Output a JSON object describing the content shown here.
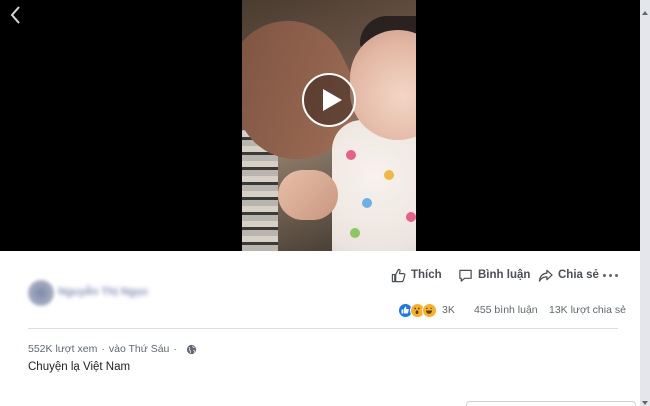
{
  "video": {
    "play_label": "Play video",
    "back_label": "Back"
  },
  "post": {
    "author_name": "Nguyễn Thị Ngọc",
    "actions": {
      "like": "Thích",
      "comment": "Bình luận",
      "share": "Chia sẻ"
    },
    "stats": {
      "reactions": [
        "like",
        "wow",
        "haha"
      ],
      "reaction_count": "3K",
      "comment_count": "455 bình luận",
      "share_count": "13K lượt chia sẻ"
    },
    "meta": {
      "views": "552K lượt xem",
      "separator": "·",
      "time": "vào Thứ Sáu",
      "privacy_icon": "globe-icon"
    },
    "description": "Chuyện lạ Việt Nam"
  },
  "colors": {
    "video_bg": "#000000",
    "like_blue": "#1877f2",
    "reaction_yellow": "#f7b125",
    "secondary_text": "#606770",
    "divider": "#dadde1"
  }
}
